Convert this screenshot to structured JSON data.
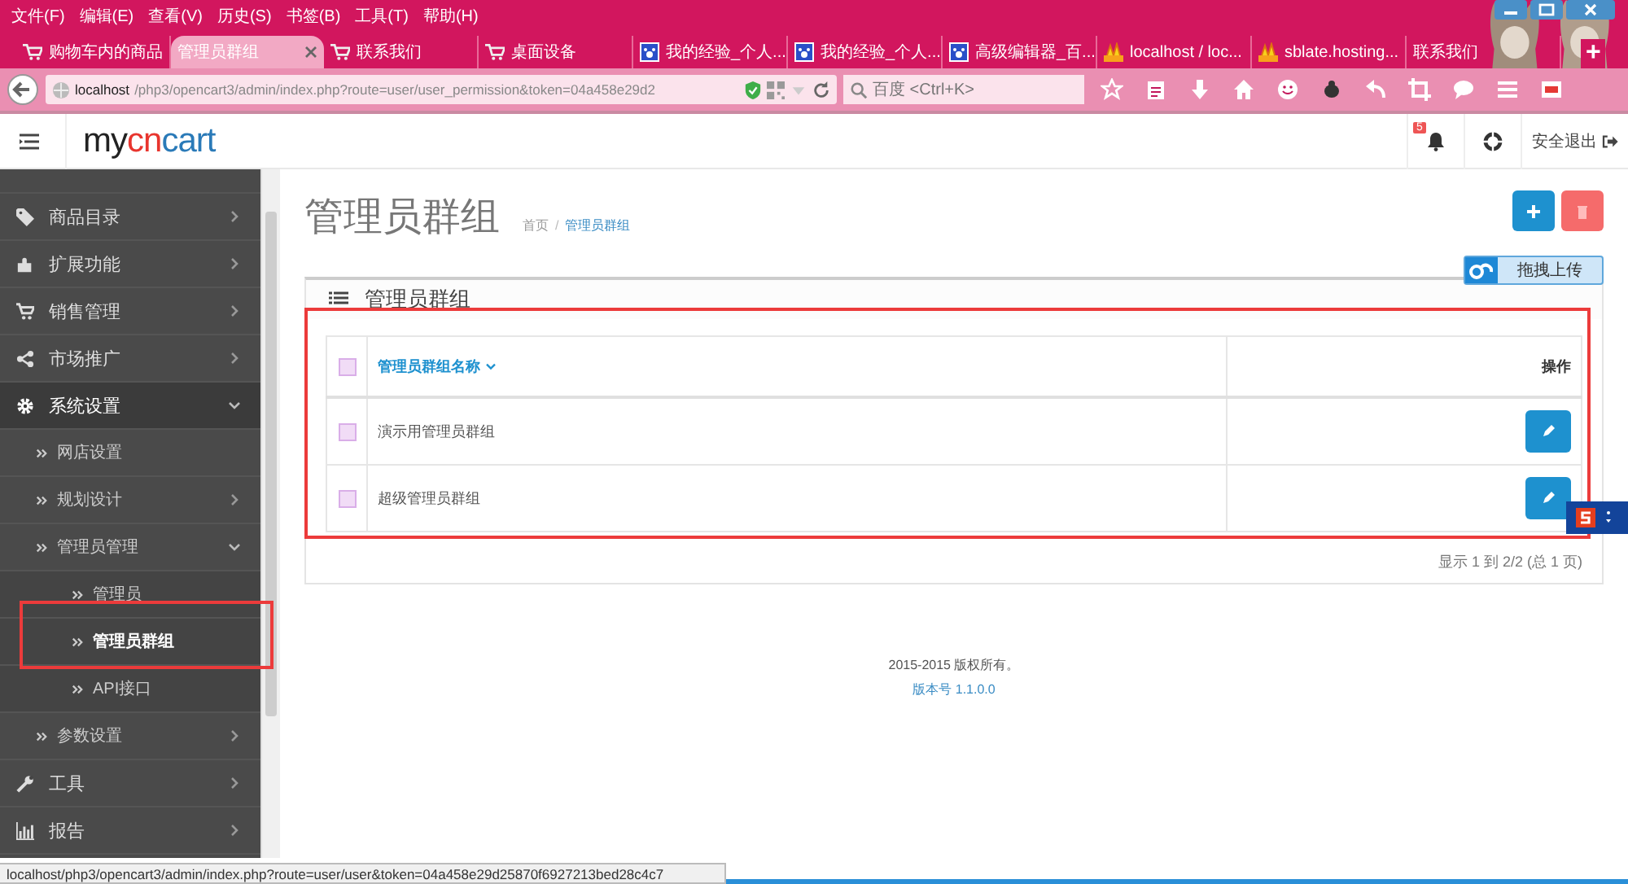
{
  "browser": {
    "menu": [
      "文件(F)",
      "编辑(E)",
      "查看(V)",
      "历史(S)",
      "书签(B)",
      "工具(T)",
      "帮助(H)"
    ],
    "tabs": [
      {
        "label": "购物车内的商品",
        "kind": "cart",
        "selected": false
      },
      {
        "label": "管理员群组",
        "kind": "plain",
        "selected": true
      },
      {
        "label": "联系我们",
        "kind": "cart",
        "selected": false
      },
      {
        "label": "桌面设备",
        "kind": "cart",
        "selected": false
      },
      {
        "label": "我的经验_个人...",
        "kind": "paw",
        "selected": false
      },
      {
        "label": "我的经验_个人...",
        "kind": "paw",
        "selected": false
      },
      {
        "label": "高级编辑器_百...",
        "kind": "paw",
        "selected": false
      },
      {
        "label": "localhost / loc...",
        "kind": "flame",
        "selected": false
      },
      {
        "label": "sblate.hosting...",
        "kind": "flame",
        "selected": false
      },
      {
        "label": "联系我们",
        "kind": "plain",
        "selected": false
      }
    ],
    "new_tab": "+",
    "url_host": "localhost",
    "url_path": "/php3/opencart3/admin/index.php?route=user/user_permission&token=04a458e29d2",
    "search": {
      "placeholder": "百度 <Ctrl+K>"
    }
  },
  "header": {
    "logo": [
      {
        "text": "my",
        "color": "#222222"
      },
      {
        "text": "cn",
        "color": "#e8352e"
      },
      {
        "text": "cart",
        "color": "#2a7ab8"
      }
    ],
    "notification_count": "5",
    "logout": "安全退出"
  },
  "sidebar": {
    "items": [
      {
        "label": "商品目录",
        "kind": "tag",
        "expanded": false,
        "selected": false
      },
      {
        "label": "扩展功能",
        "kind": "puzzle",
        "expanded": false,
        "selected": false
      },
      {
        "label": "销售管理",
        "kind": "cart",
        "expanded": false,
        "selected": false
      },
      {
        "label": "市场推广",
        "kind": "share",
        "expanded": false,
        "selected": false
      },
      {
        "label": "系统设置",
        "kind": "gear",
        "expanded": true,
        "selected": false,
        "children": [
          {
            "label": "网店设置",
            "selected": false
          },
          {
            "label": "规划设计",
            "expanded": false,
            "selected": false
          },
          {
            "label": "管理员管理",
            "expanded": true,
            "selected": false,
            "children": [
              {
                "label": "管理员",
                "selected": false
              },
              {
                "label": "管理员群组",
                "selected": true
              },
              {
                "label": "API接口",
                "selected": false
              }
            ]
          },
          {
            "label": "参数设置",
            "expanded": false,
            "selected": false
          }
        ]
      },
      {
        "label": "工具",
        "kind": "wrench",
        "expanded": false,
        "selected": false
      },
      {
        "label": "报告",
        "kind": "chart",
        "expanded": false,
        "selected": false
      }
    ]
  },
  "page": {
    "title": "管理员群组",
    "breadcrumb": [
      "首页",
      "管理员群组"
    ],
    "breadcrumb_separator": "/",
    "upload": "拖拽上传"
  },
  "panel": {
    "title": "管理员群组",
    "select_all_checked": false,
    "columns": [
      "管理员群组名称",
      "操作"
    ],
    "rows": [
      {
        "name": "演示用管理员群组",
        "checked": false
      },
      {
        "name": "超级管理员群组",
        "checked": false
      }
    ],
    "pagination": "显示 1 到 2/2 (总 1 页)"
  },
  "footer": {
    "copyright": "2015-2015 版权所有。",
    "version": "版本号 1.1.0.0"
  },
  "status_bar": "localhost/php3/opencart3/admin/index.php?route=user/user&token=04a458e29d25870f6927213bed28c4c7"
}
